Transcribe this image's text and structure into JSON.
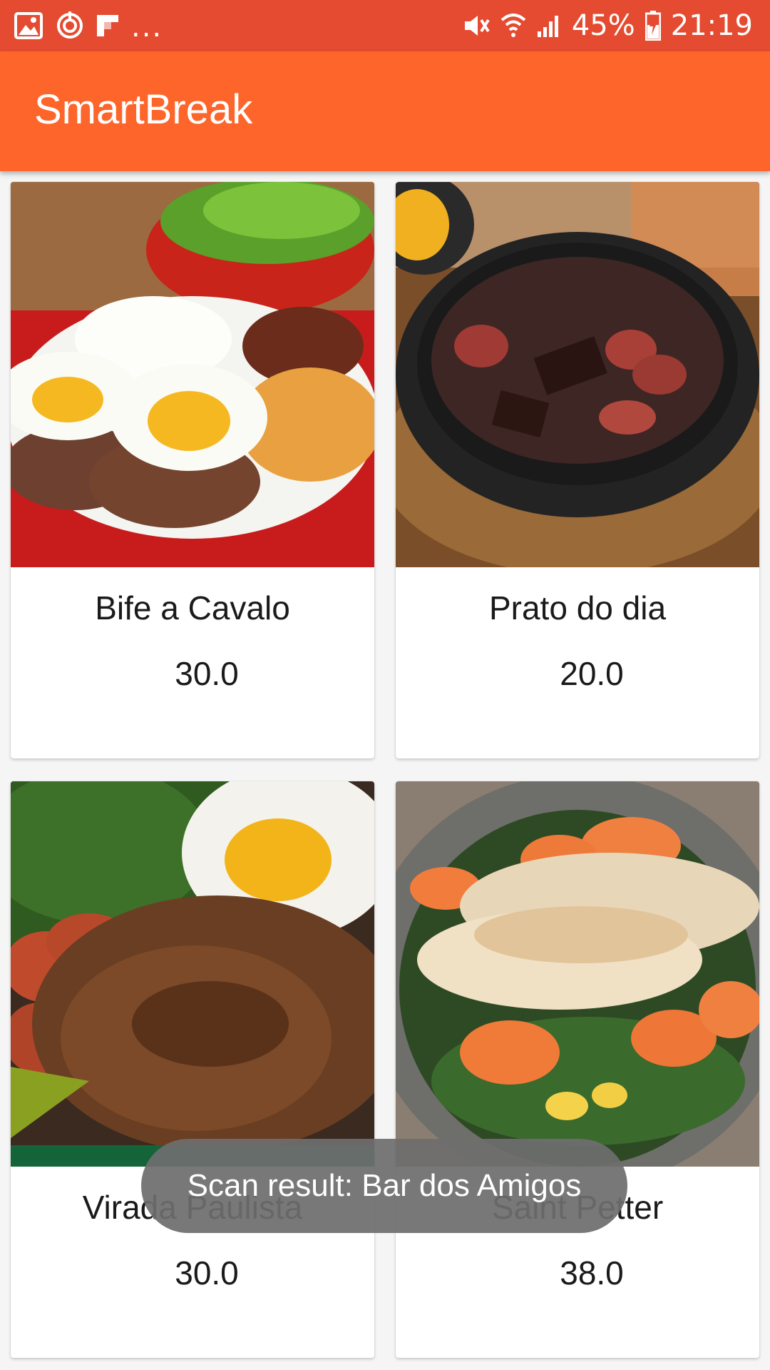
{
  "status_bar": {
    "icons_left": [
      "gallery-icon",
      "sync-icon",
      "flipboard-icon"
    ],
    "overflow": "...",
    "icons_right": [
      "mute-icon",
      "wifi-icon",
      "signal-icon"
    ],
    "battery_percent": "45%",
    "time": "21:19"
  },
  "app_bar": {
    "title": "SmartBreak"
  },
  "menu": {
    "items": [
      {
        "name": "Bife a Cavalo",
        "price": "30.0"
      },
      {
        "name": "Prato do dia",
        "price": "20.0"
      },
      {
        "name": "Virada Paulista",
        "price": "30.0"
      },
      {
        "name": "Saint Petter",
        "price": "38.0"
      }
    ]
  },
  "toast": {
    "message": "Scan result: Bar dos Amigos"
  },
  "colors": {
    "status_bar": "#e44b30",
    "app_bar": "#fe652a",
    "background": "#f5f5f5"
  }
}
